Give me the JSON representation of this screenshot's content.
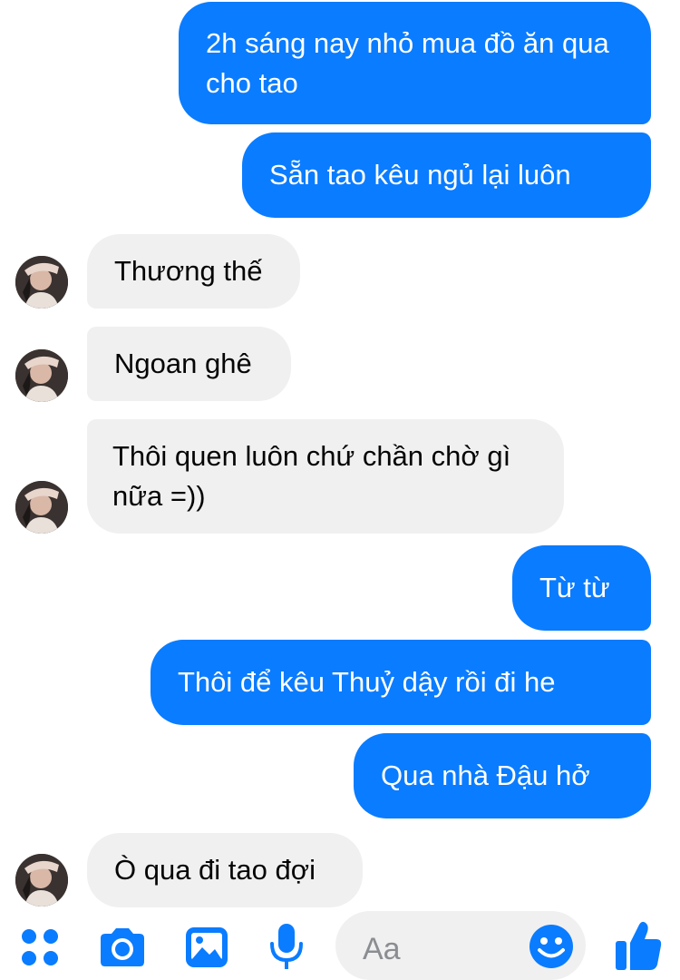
{
  "messages": [
    {
      "direction": "out",
      "text": "2h sáng nay nhỏ mua đồ ăn qua cho tao"
    },
    {
      "direction": "out",
      "text": "Sẵn tao kêu ngủ lại luôn"
    },
    {
      "direction": "in",
      "text": "Thương thế"
    },
    {
      "direction": "in",
      "text": "Ngoan ghê"
    },
    {
      "direction": "in",
      "text": "Thôi quen luôn chứ chần chờ gì nữa =))"
    },
    {
      "direction": "out",
      "text": "Từ từ"
    },
    {
      "direction": "out",
      "text": "Thôi để kêu Thuỷ dậy rồi đi he"
    },
    {
      "direction": "out",
      "text": "Qua nhà Đậu hở"
    },
    {
      "direction": "in",
      "text": "Ò qua đi tao đợi"
    }
  ],
  "composer": {
    "placeholder": "Aa",
    "icons": [
      "menu-dots-icon",
      "camera-icon",
      "image-icon",
      "microphone-icon",
      "emoji-icon",
      "thumbs-up-icon"
    ]
  },
  "colors": {
    "outgoing_bubble": "#0a7cff",
    "incoming_bubble": "#f0f0f0",
    "accent": "#0a7cff"
  }
}
